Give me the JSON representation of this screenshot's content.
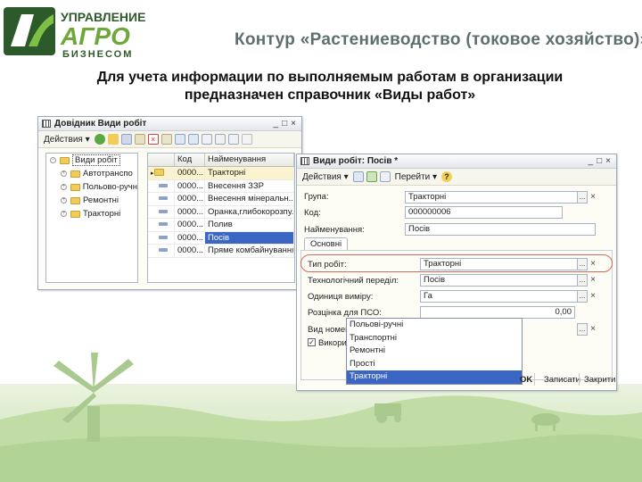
{
  "header": {
    "logo_line1": "УПРАВЛЕНИЕ",
    "logo_line2": "АГРО",
    "logo_line3": "БИЗНЕСОМ",
    "title": "Контур «Растениеводство (токовое хозяйство)»"
  },
  "slide_text": {
    "line1": "Для учета информации по выполняемым работам в организации",
    "line2": "предназначен справочник «Виды работ»"
  },
  "list_window": {
    "title": "Довідник Види робіт",
    "buttons": {
      "min": "_",
      "max": "□",
      "close": "×"
    },
    "toolbar": {
      "actions_label": "Действия ▾"
    },
    "tree": {
      "root": "Види робіт",
      "items": [
        "Автотранспо",
        "Польово-ручн",
        "Ремонтні",
        "Тракторні"
      ]
    },
    "grid": {
      "columns": [
        "Код",
        "Найменування"
      ],
      "rows": [
        {
          "code": "0000...",
          "name": "Тракторні"
        },
        {
          "code": "0000...",
          "name": "Внесення ЗЗР"
        },
        {
          "code": "0000...",
          "name": "Внесення мінеральн..."
        },
        {
          "code": "0000...",
          "name": "Оранка,глибокорозпу..."
        },
        {
          "code": "0000...",
          "name": "Полив"
        },
        {
          "code": "0000...",
          "name": "Посів"
        },
        {
          "code": "0000...",
          "name": "Пряме комбайнування"
        }
      ]
    }
  },
  "form_window": {
    "title": "Види робіт: Посів *",
    "buttons": {
      "min": "_",
      "max": "□",
      "close": "×"
    },
    "toolbar": {
      "actions_label": "Действия ▾",
      "goto_label": "Перейти ▾"
    },
    "fields": {
      "group_label": "Група:",
      "group_value": "Тракторні",
      "code_label": "Код:",
      "code_value": "000000006",
      "name_label": "Найменування:",
      "name_value": "Посів"
    },
    "tab": "Основні",
    "main": {
      "work_type_label": "Тип робіт:",
      "work_type_value": "Тракторні",
      "tech_label": "Технологічний переділ:",
      "tech_value": "Посів",
      "unit_label": "Одиниця виміру:",
      "unit_value": "Га",
      "rate_label": "Розцінка для ПСО:",
      "rate_value": "0,00",
      "nomen_label": "Вид номен",
      "use_label": "Викорис"
    },
    "dropdown_options": [
      "Польові-ручні",
      "Транспортні",
      "Ремонтні",
      "Прості",
      "Тракторні"
    ],
    "footer": {
      "ok": "OK",
      "save": "Записати",
      "close": "Закрити"
    }
  },
  "colors": {
    "accent_green": "#6fa83a",
    "selection": "#3b66c4",
    "highlight": "#d46a5a"
  }
}
